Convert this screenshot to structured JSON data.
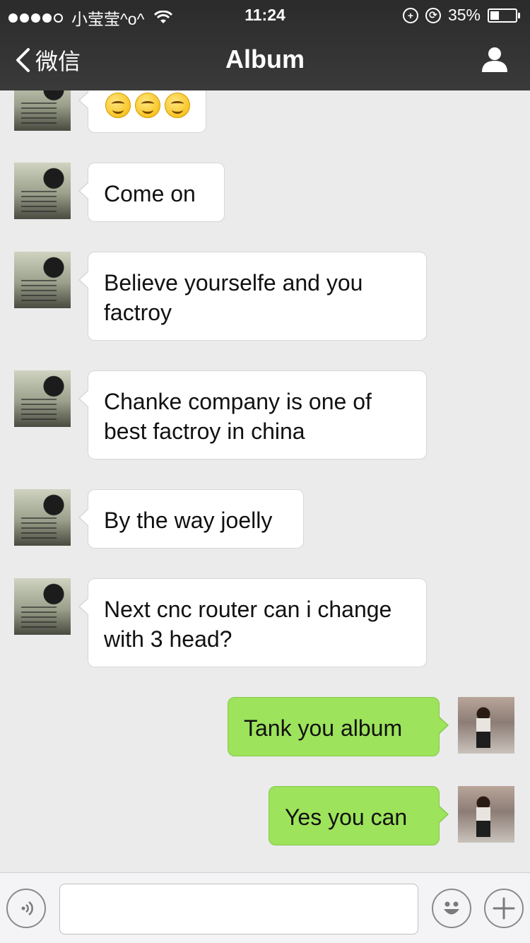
{
  "status_bar": {
    "carrier": "小莹莹^o^",
    "time": "11:24",
    "battery": "35%",
    "battery_level": 0.35
  },
  "nav": {
    "back_label": "微信",
    "title": "Album",
    "profile_icon": "person-icon"
  },
  "messages": [
    {
      "side": "in",
      "type": "emoji",
      "content": "😊😊😊"
    },
    {
      "side": "in",
      "text": "Come on"
    },
    {
      "side": "in",
      "text": "Believe yourselfe and you factroy"
    },
    {
      "side": "in",
      "text": "Chanke company is one of best factroy in china"
    },
    {
      "side": "in",
      "text": "By the way joelly"
    },
    {
      "side": "in",
      "text": "Next cnc router can i change with 3 head?"
    },
    {
      "side": "out",
      "text": "Tank you album"
    },
    {
      "side": "out",
      "text": "Yes you can"
    }
  ],
  "input_bar": {
    "voice_icon": "voice-icon",
    "emoji_icon": "emoji-icon",
    "plus_icon": "plus-icon",
    "message_value": ""
  },
  "colors": {
    "incoming_bubble": "#ffffff",
    "outgoing_bubble": "#9de35b",
    "background": "#ebebeb",
    "nav_bar": "#333333"
  }
}
